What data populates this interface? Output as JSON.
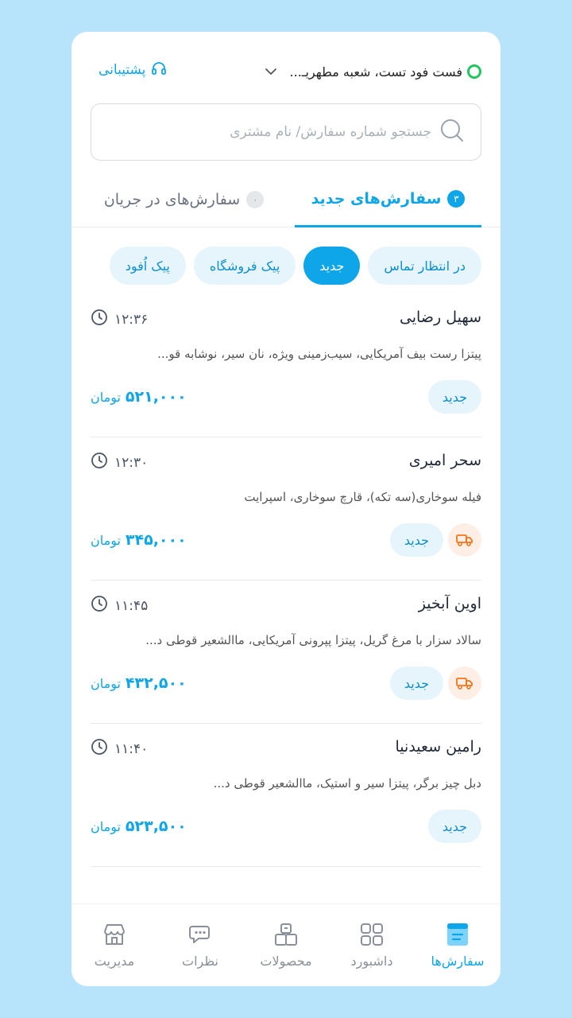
{
  "header": {
    "branch_name": "فست فود تست، شعبه مطهریـ...",
    "support_label": "پشتیبانی"
  },
  "search": {
    "placeholder": "جستجو شماره سفارش/ نام مشتری",
    "value": ""
  },
  "tabs": [
    {
      "label": "سفارش‌های جدید",
      "count": "۳",
      "active": true
    },
    {
      "label": "سفارش‌های در جریان",
      "count": "۰",
      "active": false
    }
  ],
  "filters": [
    {
      "label": "در انتظار تماس",
      "selected": false
    },
    {
      "label": "جدید",
      "selected": true
    },
    {
      "label": "پیک فروشگاه",
      "selected": false
    },
    {
      "label": "پیک اُفود",
      "selected": false
    }
  ],
  "currency": "تومان",
  "orders": [
    {
      "name": "سهیل رضایی",
      "time": "۱۲:۳۶",
      "items": "پیتزا رست بیف آمریکایی، سیب‌زمینی ویژه، نان سیر، نوشابه قو...",
      "status": "جدید",
      "price": "۵۲۱,۰۰۰",
      "delivery": false
    },
    {
      "name": "سحر امیری",
      "time": "۱۲:۳۰",
      "items": "فیله سوخاری(سه تکه)، قارچ سوخاری، اسپرایت",
      "status": "جدید",
      "price": "۳۴۵,۰۰۰",
      "delivery": true
    },
    {
      "name": "اوین آبخیز",
      "time": "۱۱:۴۵",
      "items": "سالاد سزار با مرغ گریل، پیتزا پپرونی آمریکایی، ماالشعیر قوطی د...",
      "status": "جدید",
      "price": "۴۳۲,۵۰۰",
      "delivery": true
    },
    {
      "name": "رامین سعیدنیا",
      "time": "۱۱:۴۰",
      "items": "دبل چیز برگر، پیتزا سیر و استیک، ماالشعیر قوطی د...",
      "status": "جدید",
      "price": "۵۲۳,۵۰۰",
      "delivery": false
    }
  ],
  "bottom_nav": [
    {
      "label": "سفارش‌ها",
      "icon": "orders-icon",
      "active": true
    },
    {
      "label": "داشبورد",
      "icon": "dashboard-icon",
      "active": false
    },
    {
      "label": "محصولات",
      "icon": "products-icon",
      "active": false
    },
    {
      "label": "نظرات",
      "icon": "comments-icon",
      "active": false
    },
    {
      "label": "مدیریت",
      "icon": "store-icon",
      "active": false
    }
  ],
  "colors": {
    "accent": "#0ea5e9",
    "status_online": "#22c55e",
    "delivery_badge": "#f97316"
  }
}
